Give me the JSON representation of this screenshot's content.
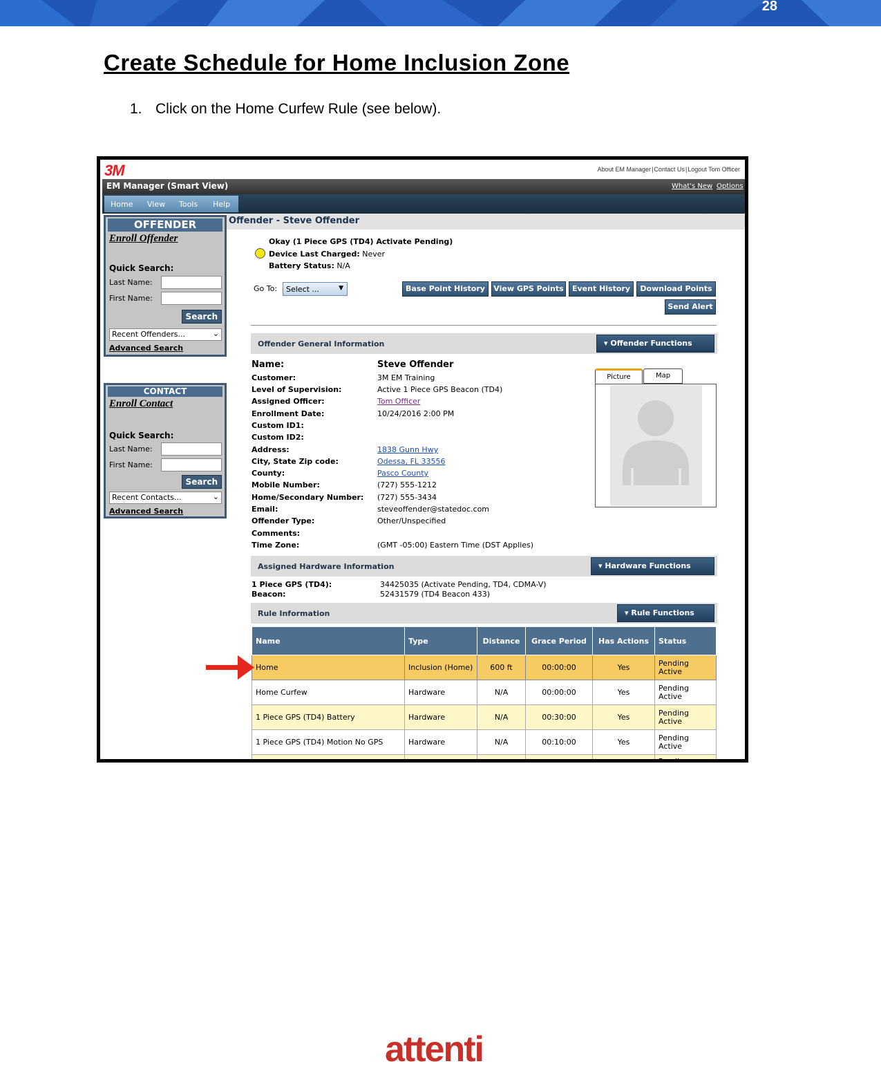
{
  "page": {
    "number": "28",
    "title": "Create Schedule for Home Inclusion Zone",
    "step_number": "1.",
    "step_text": "Click on the Home Curfew Rule (see below).",
    "footer_logo": "attenti"
  },
  "app": {
    "brand": "3M",
    "top_links": [
      "About EM Manager",
      "Contact Us",
      "Logout Tom Officer"
    ],
    "title": "EM Manager (Smart View)",
    "title_links": [
      "What's New",
      "Options"
    ],
    "menu": [
      "Home",
      "View",
      "Tools",
      "Help"
    ]
  },
  "sidebar": {
    "offender": {
      "header": "OFFENDER",
      "enroll": "Enroll Offender",
      "quick_search": "Quick Search:",
      "last_name": "Last Name:",
      "first_name": "First Name:",
      "search": "Search",
      "recent": "Recent Offenders...",
      "advanced": "Advanced Search"
    },
    "contact": {
      "header": "CONTACT",
      "enroll": "Enroll Contact",
      "quick_search": "Quick Search:",
      "last_name": "Last Name:",
      "first_name": "First Name:",
      "search": "Search",
      "recent": "Recent Contacts...",
      "advanced": "Advanced Search"
    }
  },
  "offender": {
    "header": "Offender - Steve Offender",
    "status_line": "Okay (1 Piece GPS (TD4) Activate Pending)",
    "charged_label": "Device Last Charged:",
    "charged_value": "Never",
    "battery_label": "Battery Status:",
    "battery_value": "N/A",
    "goto_label": "Go To:",
    "goto_select": "Select ...",
    "buttons": [
      "Base Point History",
      "View GPS Points",
      "Event History",
      "Download Points",
      "Send Alert"
    ]
  },
  "general": {
    "title": "Offender General Information",
    "functions": "Offender Functions",
    "name_label": "Name:",
    "name_value": "Steve Offender",
    "fields": [
      {
        "k": "Customer:",
        "v": "3M EM Training"
      },
      {
        "k": "Level of Supervision:",
        "v": "Active 1 Piece GPS Beacon (TD4)"
      },
      {
        "k": "Assigned Officer:",
        "v": "Tom Officer"
      },
      {
        "k": "Enrollment Date:",
        "v": "10/24/2016 2:00 PM"
      },
      {
        "k": "Custom ID1:",
        "v": ""
      },
      {
        "k": "Custom ID2:",
        "v": ""
      },
      {
        "k": "Address:",
        "v": "1838 Gunn Hwy"
      },
      {
        "k": "City, State Zip code:",
        "v": "Odessa, FL 33556"
      },
      {
        "k": "County:",
        "v": "Pasco County"
      },
      {
        "k": "Mobile Number:",
        "v": "(727) 555-1212"
      },
      {
        "k": "Home/Secondary Number:",
        "v": "(727) 555-3434"
      },
      {
        "k": "Email:",
        "v": "steveoffender@statedoc.com"
      },
      {
        "k": "Offender Type:",
        "v": "Other/Unspecified"
      },
      {
        "k": "Comments:",
        "v": ""
      },
      {
        "k": "Time Zone:",
        "v": "(GMT -05:00) Eastern Time (DST Applies)"
      }
    ],
    "tabs": [
      "Picture",
      "Map"
    ]
  },
  "hardware": {
    "title": "Assigned Hardware Information",
    "functions": "Hardware Functions",
    "rows": [
      {
        "k": "1 Piece GPS (TD4):",
        "v": "34425035 (Activate Pending, TD4, CDMA-V)"
      },
      {
        "k": "Beacon:",
        "v": "52431579 (TD4 Beacon 433)"
      }
    ]
  },
  "rules": {
    "title": "Rule Information",
    "functions": "Rule Functions",
    "headers": [
      "Name",
      "Type",
      "Distance",
      "Grace Period",
      "Has Actions",
      "Status"
    ],
    "rows": [
      {
        "name": "Home",
        "type": "Inclusion (Home)",
        "distance": "600 ft",
        "grace": "00:00:00",
        "actions": "Yes",
        "status": "Pending Active"
      },
      {
        "name": "Home Curfew",
        "type": "Hardware",
        "distance": "N/A",
        "grace": "00:00:00",
        "actions": "Yes",
        "status": "Pending Active"
      },
      {
        "name": "1 Piece GPS (TD4) Battery",
        "type": "Hardware",
        "distance": "N/A",
        "grace": "00:30:00",
        "actions": "Yes",
        "status": "Pending Active"
      },
      {
        "name": "1 Piece GPS (TD4) Motion No GPS",
        "type": "Hardware",
        "distance": "N/A",
        "grace": "00:10:00",
        "actions": "Yes",
        "status": "Pending Active"
      },
      {
        "name": "",
        "type": "",
        "distance": "",
        "grace": "",
        "actions": "",
        "status": "Pending"
      }
    ]
  }
}
